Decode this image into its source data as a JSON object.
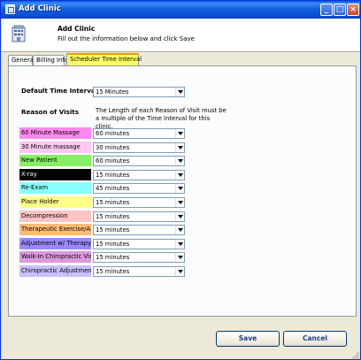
{
  "window": {
    "title": "Add Clinic"
  },
  "header": {
    "title": "Add Clinic",
    "subtitle": "Fill out the information below and click Save"
  },
  "tabs": [
    {
      "label": "General",
      "active": false
    },
    {
      "label": "Billing Info",
      "active": false
    },
    {
      "label": "Scheduler Time Interval",
      "active": true
    }
  ],
  "scheduler": {
    "default_interval_label": "Default Time Interval",
    "default_interval_value": "15 Minutes",
    "reasons_label": "Reason of Visits",
    "note": "The Length of each Reason of Visit must be a multiple of the Time Interval for this clinic.",
    "reasons": [
      {
        "name": "60 Minute Massage",
        "color": "#ff88ee",
        "text_color": "#000000",
        "length": "60 minutes"
      },
      {
        "name": "30 Minute massage",
        "color": "#ffc8f0",
        "text_color": "#000000",
        "length": "30 minutes"
      },
      {
        "name": "New Patient",
        "color": "#88ee66",
        "text_color": "#000000",
        "length": "60 minutes"
      },
      {
        "name": "X-ray",
        "color": "#000000",
        "text_color": "#ffffff",
        "length": "15 minutes"
      },
      {
        "name": "Re-Exam",
        "color": "#88ffff",
        "text_color": "#000000",
        "length": "45 minutes"
      },
      {
        "name": "Place Holder",
        "color": "#ffff88",
        "text_color": "#000000",
        "length": "15 minutes"
      },
      {
        "name": "Decompression",
        "color": "#ffc4c4",
        "text_color": "#000000",
        "length": "15 minutes"
      },
      {
        "name": "Therapeutic Exercise/ADL",
        "color": "#ffbb77",
        "text_color": "#000000",
        "length": "15 minutes"
      },
      {
        "name": "Adjustment w/ Therapy",
        "color": "#9988ff",
        "text_color": "#000000",
        "length": "15 minutes"
      },
      {
        "name": "Walk-In Chiropractic Visit",
        "color": "#dd99dd",
        "text_color": "#000000",
        "length": "15 minutes"
      },
      {
        "name": "Chiropractic Adjustment",
        "color": "#c8c0ff",
        "text_color": "#000000",
        "length": "15 minutes"
      }
    ]
  },
  "buttons": {
    "save": "Save",
    "cancel": "Cancel"
  },
  "icons": {
    "window": "clinic-icon",
    "header": "building-icon"
  }
}
